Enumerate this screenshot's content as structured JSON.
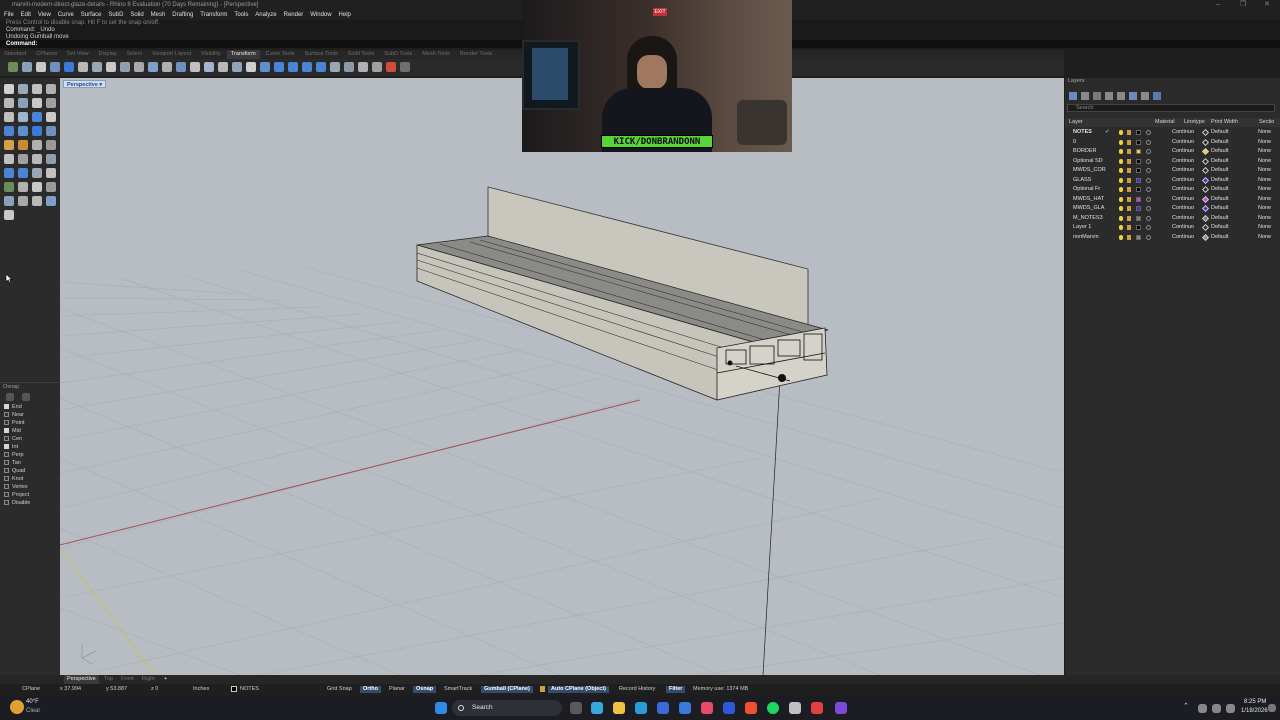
{
  "window": {
    "title": "marvin-modern-direct-glaze-details - Rhino 8 Evaluation (70 Days Remaining) - [Perspective]",
    "controls": [
      "–",
      "❐",
      "✕"
    ]
  },
  "menu": [
    "File",
    "Edit",
    "View",
    "Curve",
    "Surface",
    "SubD",
    "Solid",
    "Mesh",
    "Drafting",
    "Transform",
    "Tools",
    "Analyze",
    "Render",
    "Window",
    "Help"
  ],
  "command_history": [
    "Press Control to disable snap. Hit F to set the snap on/off.",
    "Command: _Undo",
    "Undoing Gumball move"
  ],
  "command_prompt": "Command:",
  "toolbar_tabs": [
    {
      "label": "Standard",
      "active": false
    },
    {
      "label": "CPlanes",
      "active": false
    },
    {
      "label": "Set View",
      "active": false
    },
    {
      "label": "Display",
      "active": false
    },
    {
      "label": "Select",
      "active": false
    },
    {
      "label": "Viewport Layout",
      "active": false
    },
    {
      "label": "Visibility",
      "active": false
    },
    {
      "label": "Transform",
      "active": true
    },
    {
      "label": "Curve Tools",
      "active": false
    },
    {
      "label": "Surface Tools",
      "active": false
    },
    {
      "label": "Solid Tools",
      "active": false
    },
    {
      "label": "SubD Tools",
      "active": false
    },
    {
      "label": "Mesh Tools",
      "active": false
    },
    {
      "label": "Render Tools",
      "active": false
    }
  ],
  "viewport": {
    "label": "Perspective",
    "label_arrow": "▾",
    "background": "#b8bcc3"
  },
  "osnap": {
    "title": "Osnap",
    "items": [
      {
        "label": "End",
        "checked": true
      },
      {
        "label": "Near",
        "checked": false
      },
      {
        "label": "Point",
        "checked": false
      },
      {
        "label": "Mid",
        "checked": true
      },
      {
        "label": "Cen",
        "checked": false
      },
      {
        "label": "Int",
        "checked": true
      },
      {
        "label": "Perp",
        "checked": false
      },
      {
        "label": "Tan",
        "checked": false
      },
      {
        "label": "Quad",
        "checked": false
      },
      {
        "label": "Knot",
        "checked": false
      },
      {
        "label": "Vertex",
        "checked": false
      },
      {
        "label": "Project",
        "checked": false
      },
      {
        "label": "Disable",
        "checked": false
      }
    ]
  },
  "layers": {
    "title": "Layers",
    "search_placeholder": "Search",
    "columns": {
      "layer": "Layer",
      "material": "Material",
      "linetype": "Linetype",
      "print_width": "Print Width",
      "section": "Sectio"
    },
    "rows": [
      {
        "name": "NOTES",
        "color": "#000000",
        "linetype": "Continuo",
        "print_width": "Default",
        "section": "None",
        "current": true
      },
      {
        "name": "0",
        "color": "#000000",
        "linetype": "Continuo",
        "print_width": "Default",
        "section": "None",
        "current": false
      },
      {
        "name": "BORDER",
        "color": "#f2d23c",
        "linetype": "Continuo",
        "print_width": "Default",
        "section": "None",
        "current": false
      },
      {
        "name": "Optional SD",
        "color": "#000000",
        "linetype": "Continuo",
        "print_width": "Default",
        "section": "None",
        "current": false
      },
      {
        "name": "MWDS_COR",
        "color": "#000000",
        "linetype": "Continuo",
        "print_width": "Default",
        "section": "None",
        "current": false
      },
      {
        "name": "GLASS",
        "color": "#2a36e0",
        "linetype": "Continuo",
        "print_width": "Default",
        "section": "None",
        "current": false
      },
      {
        "name": "Optional Fr",
        "color": "#000000",
        "linetype": "Continuo",
        "print_width": "Default",
        "section": "None",
        "current": false
      },
      {
        "name": "MWDS_HAT",
        "color": "#d63adf",
        "linetype": "Continuo",
        "print_width": "Default",
        "section": "None",
        "current": false
      },
      {
        "name": "MWDS_GLA",
        "color": "#2a36e0",
        "linetype": "Continuo",
        "print_width": "Default",
        "section": "None",
        "current": false
      },
      {
        "name": "M_NOTES3",
        "color": "#7a7a7a",
        "linetype": "Continuo",
        "print_width": "Default",
        "section": "None",
        "current": false
      },
      {
        "name": "Layer 1",
        "color": "#000000",
        "linetype": "Continuo",
        "print_width": "Default",
        "section": "None",
        "current": false
      },
      {
        "name": "nonMarvin",
        "color": "#8a8a8a",
        "linetype": "Continuo",
        "print_width": "Default",
        "section": "None",
        "current": false
      }
    ]
  },
  "viewport_tabs": [
    {
      "label": "Perspective",
      "active": true
    },
    {
      "label": "Top",
      "active": false
    },
    {
      "label": "Front",
      "active": false
    },
    {
      "label": "Right",
      "active": false
    },
    {
      "label": "+",
      "active": false
    }
  ],
  "status": {
    "cplane": "CPlane",
    "x": "x 37.994",
    "y": "y 53.887",
    "z": "z 0",
    "units": "Inches",
    "layer": "NOTES",
    "grid_snap": "Grid Snap",
    "ortho": "Ortho",
    "planar": "Planar",
    "osnap": "Osnap",
    "smarttrack": "SmartTrack",
    "gumball": "Gumball (CPlane)",
    "auto_cplane": "Auto CPlane (Object)",
    "record_history": "Record History",
    "filter": "Filter",
    "memory": "Memory use: 1374 MB"
  },
  "taskbar": {
    "weather_temp": "40°F",
    "weather_desc": "Clear",
    "search_label": "Search",
    "time": "8:25 PM",
    "date": "1/18/2026"
  },
  "webcam": {
    "overlay_text": "KICK/DONBRANDONN",
    "sign_text": "EXIT"
  }
}
